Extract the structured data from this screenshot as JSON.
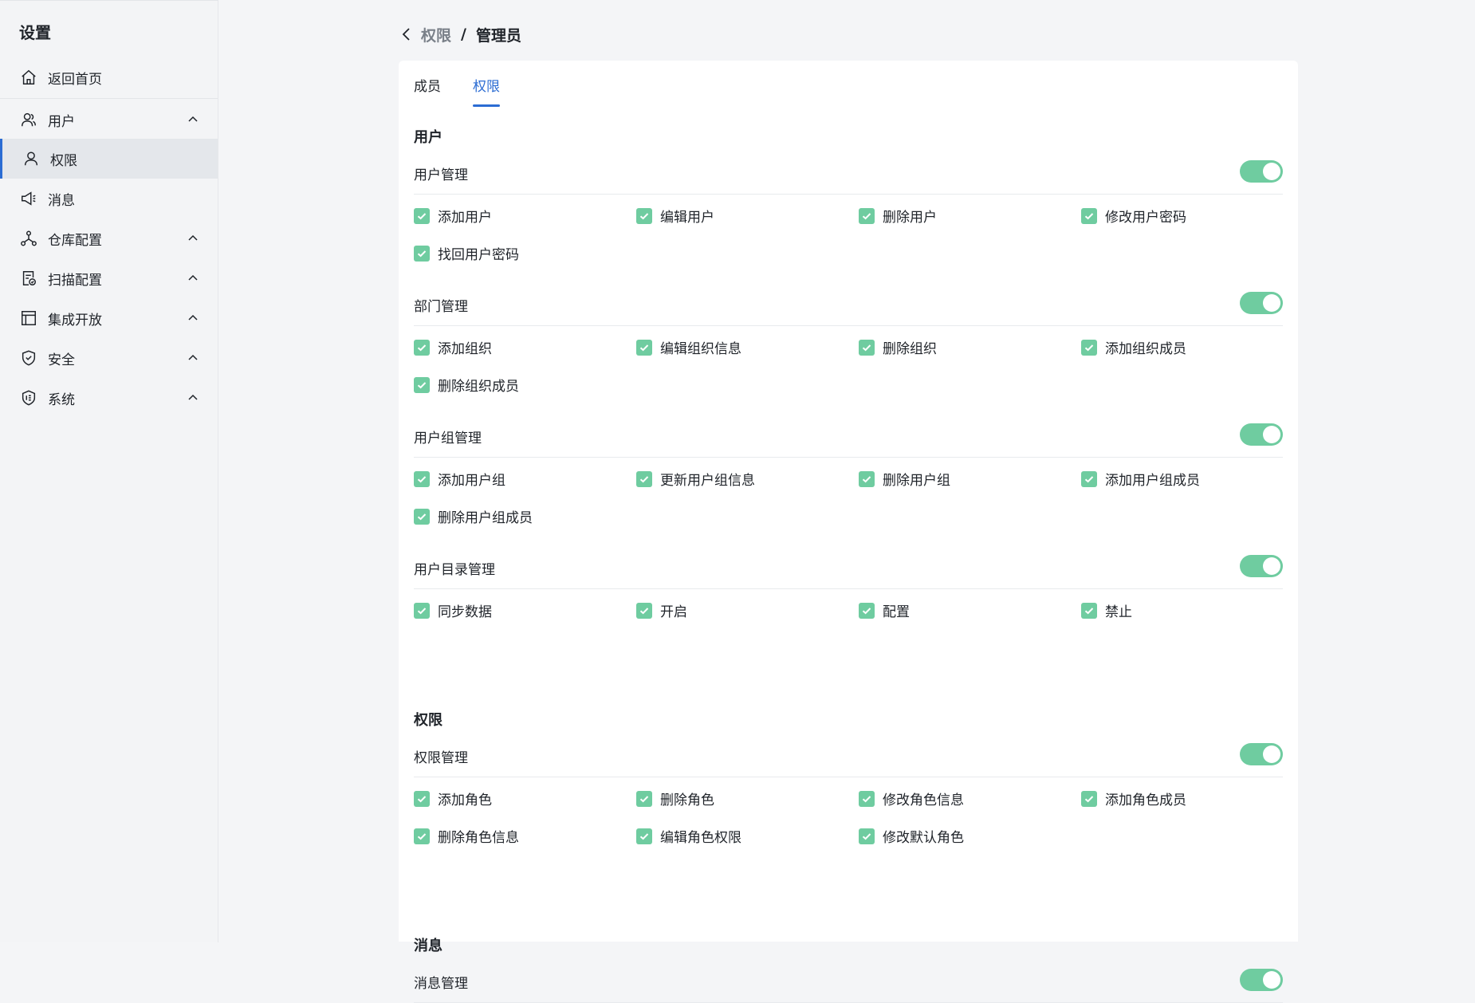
{
  "sidebar": {
    "title": "设置",
    "items": [
      {
        "label": "返回首页",
        "icon": "home-icon"
      },
      {
        "label": "用户",
        "icon": "users-icon"
      },
      {
        "label": "权限",
        "icon": "user-icon"
      },
      {
        "label": "消息",
        "icon": "megaphone-icon"
      },
      {
        "label": "仓库配置",
        "icon": "network-icon"
      },
      {
        "label": "扫描配置",
        "icon": "scan-doc-icon"
      },
      {
        "label": "集成开放",
        "icon": "layout-icon"
      },
      {
        "label": "安全",
        "icon": "shield-check-icon"
      },
      {
        "label": "系统",
        "icon": "system-shield-icon"
      }
    ]
  },
  "breadcrumb": {
    "parent": "权限",
    "separator": "/",
    "current": "管理员"
  },
  "tabs": [
    "成员",
    "权限"
  ],
  "sections": [
    {
      "title": "用户",
      "groups": [
        {
          "title": "用户管理",
          "items": [
            "添加用户",
            "编辑用户",
            "删除用户",
            "修改用户密码",
            "找回用户密码"
          ]
        },
        {
          "title": "部门管理",
          "items": [
            "添加组织",
            "编辑组织信息",
            "删除组织",
            "添加组织成员",
            "删除组织成员"
          ]
        },
        {
          "title": "用户组管理",
          "items": [
            "添加用户组",
            "更新用户组信息",
            "删除用户组",
            "添加用户组成员",
            "删除用户组成员"
          ]
        },
        {
          "title": "用户目录管理",
          "items": [
            "同步数据",
            "开启",
            "配置",
            "禁止"
          ]
        }
      ]
    },
    {
      "title": "权限",
      "groups": [
        {
          "title": "权限管理",
          "items": [
            "添加角色",
            "删除角色",
            "修改角色信息",
            "添加角色成员",
            "删除角色信息",
            "编辑角色权限",
            "修改默认角色"
          ]
        }
      ]
    },
    {
      "title": "消息",
      "groups": [
        {
          "title": "消息管理",
          "items": []
        }
      ]
    }
  ],
  "colors": {
    "accent": "#2b6cd3",
    "toggle_on": "#6fcca0",
    "checkbox": "#6fcca0"
  }
}
